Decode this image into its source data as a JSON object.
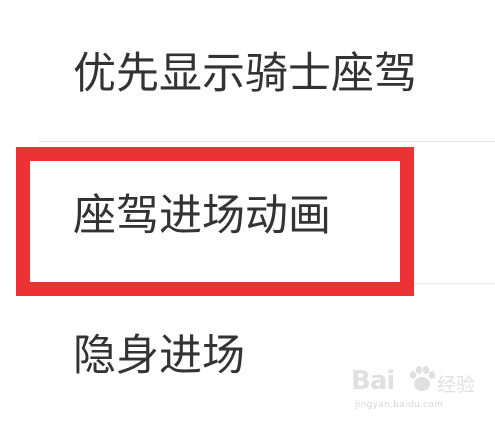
{
  "settings": {
    "items": [
      {
        "label": "优先显示骑士座驾"
      },
      {
        "label": "座驾进场动画"
      },
      {
        "label": "隐身进场"
      }
    ]
  },
  "annotation": {
    "highlight_color": "#ed3236"
  },
  "watermark": {
    "logo_text": "Bai",
    "word_text": "经验",
    "url_text": "jingyan.baidu.com"
  }
}
